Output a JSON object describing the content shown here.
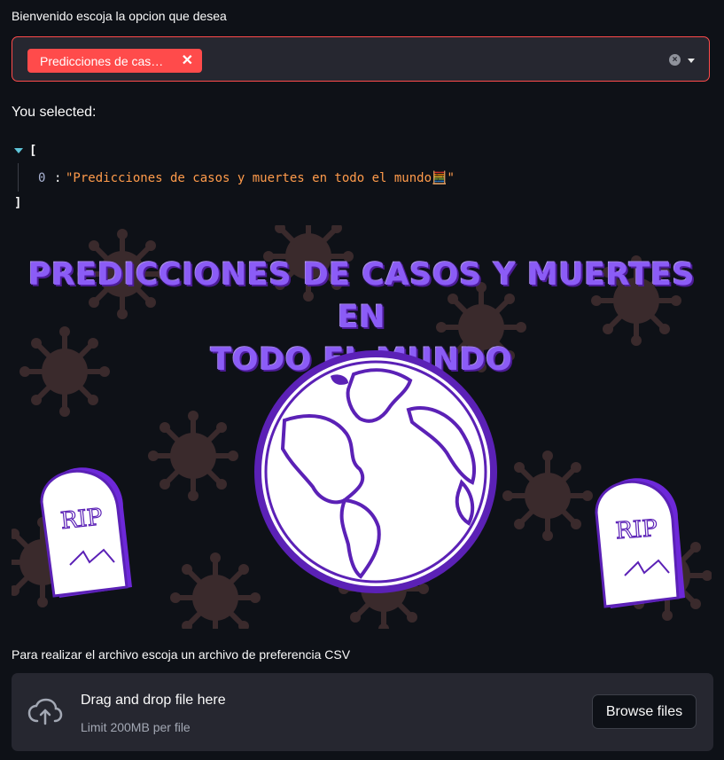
{
  "select": {
    "label": "Bienvenido escoja la opcion que desea",
    "selected_tag": "Predicciones de cas…",
    "tag_remove": "✕",
    "clear": "×"
  },
  "result": {
    "heading": "You selected:",
    "json_open": "[",
    "json_close": "]",
    "items": [
      {
        "index": "0",
        "value": "\"Predicciones de casos y muertes en todo el mundo🧮\""
      }
    ]
  },
  "banner": {
    "title_line1": "PREDICCIONES DE CASOS Y MUERTES EN",
    "title_line2": "TODO EL MUNDO",
    "tombstone_text": "RIP",
    "colors": {
      "accent": "#7c3aed",
      "virus": "#3a2a2c",
      "background": "#0e1117"
    }
  },
  "uploader": {
    "label": "Para realizar el archivo escoja un archivo de preferencia CSV",
    "drop_text": "Drag and drop file here",
    "limit_text": "Limit 200MB per file",
    "browse_label": "Browse files",
    "icon": "cloud-upload-icon"
  },
  "colors": {
    "primary": "#ff4b4b",
    "panel": "#262730",
    "background": "#0e1117"
  }
}
